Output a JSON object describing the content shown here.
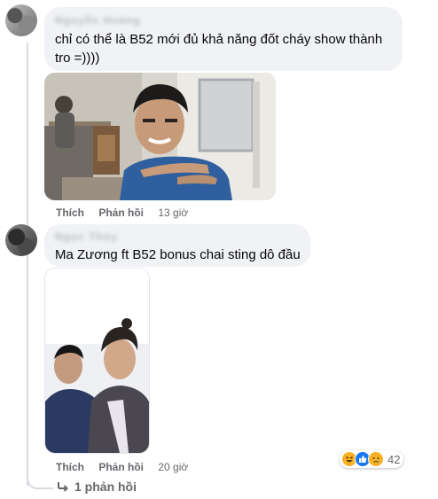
{
  "comments": [
    {
      "author": "Nguyễn Hoàng",
      "text": "chỉ có thể là B52 mới đủ khả năng đốt cháy show thành tro =))))",
      "like_label": "Thích",
      "reply_label": "Phản hồi",
      "time": "13 giờ",
      "image": "photo-man-gesturing-indoor"
    },
    {
      "author": "Ngọc Thủy",
      "text": "Ma Zương ft B52 bonus chai sting dô đầu",
      "like_label": "Thích",
      "reply_label": "Phản hồi",
      "time": "20 giờ",
      "image": "photo-two-men-selfie",
      "reactions": {
        "icons": [
          "haha-icon",
          "like-icon",
          "sad-icon"
        ],
        "count": "42"
      }
    }
  ],
  "replies_link": "1 phản hồi",
  "colors": {
    "bubble": "#f0f2f5",
    "secondary_text": "#65676b",
    "like_blue": "#1877f2",
    "emoji_yellow": "#f7b125"
  }
}
